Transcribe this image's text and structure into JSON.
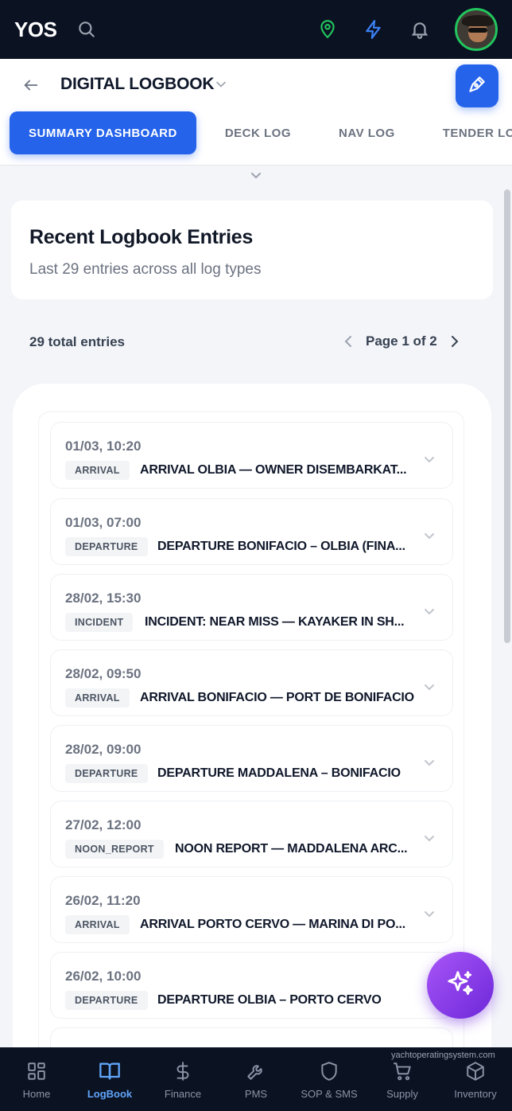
{
  "topbar": {
    "brand": "YOS",
    "icons": [
      "search-icon",
      "location-pin-icon",
      "lightning-icon",
      "bell-icon"
    ],
    "colors": {
      "background": "#0b1222",
      "pin": "#22c55e",
      "lightning": "#3b82f6",
      "avatar_ring": "#22c55e"
    }
  },
  "header": {
    "title": "DIGITAL LOGBOOK",
    "tabs": [
      {
        "label": "SUMMARY DASHBOARD",
        "active": true
      },
      {
        "label": "DECK LOG",
        "active": false
      },
      {
        "label": "NAV LOG",
        "active": false
      },
      {
        "label": "TENDER LO",
        "active": false
      }
    ],
    "accent": "#2563eb"
  },
  "summary": {
    "title": "Recent Logbook Entries",
    "subtitle": "Last 29 entries across all log types"
  },
  "pagination": {
    "total_label": "29 total entries",
    "page_label": "Page 1 of 2"
  },
  "entries": [
    {
      "date": "01/03, 10:20",
      "type": "ARRIVAL",
      "title": "ARRIVAL OLBIA — OWNER DISEMBARKAT..."
    },
    {
      "date": "01/03, 07:00",
      "type": "DEPARTURE",
      "title": "DEPARTURE BONIFACIO – OLBIA (FINA..."
    },
    {
      "date": "28/02, 15:30",
      "type": "INCIDENT",
      "title": "INCIDENT: NEAR MISS — KAYAKER IN SH..."
    },
    {
      "date": "28/02, 09:50",
      "type": "ARRIVAL",
      "title": "ARRIVAL BONIFACIO — PORT DE BONIFACIO"
    },
    {
      "date": "28/02, 09:00",
      "type": "DEPARTURE",
      "title": "DEPARTURE MADDALENA – BONIFACIO"
    },
    {
      "date": "27/02, 12:00",
      "type": "NOON_REPORT",
      "title": "NOON REPORT — MADDALENA ARC..."
    },
    {
      "date": "26/02, 11:20",
      "type": "ARRIVAL",
      "title": "ARRIVAL PORTO CERVO — MARINA DI PO..."
    },
    {
      "date": "26/02, 10:00",
      "type": "DEPARTURE",
      "title": "DEPARTURE OLBIA – PORTO CERVO"
    }
  ],
  "footer": {
    "site": "yachtoperatingsystem.com"
  },
  "bottom_nav": [
    {
      "label": "Home",
      "icon": "grid-icon",
      "active": false
    },
    {
      "label": "LogBook",
      "icon": "book-icon",
      "active": true
    },
    {
      "label": "Finance",
      "icon": "dollar-icon",
      "active": false
    },
    {
      "label": "PMS",
      "icon": "wrench-icon",
      "active": false
    },
    {
      "label": "SOP & SMS",
      "icon": "shield-icon",
      "active": false
    },
    {
      "label": "Supply",
      "icon": "cart-icon",
      "active": false
    },
    {
      "label": "Inventory",
      "icon": "box-icon",
      "active": false
    }
  ]
}
